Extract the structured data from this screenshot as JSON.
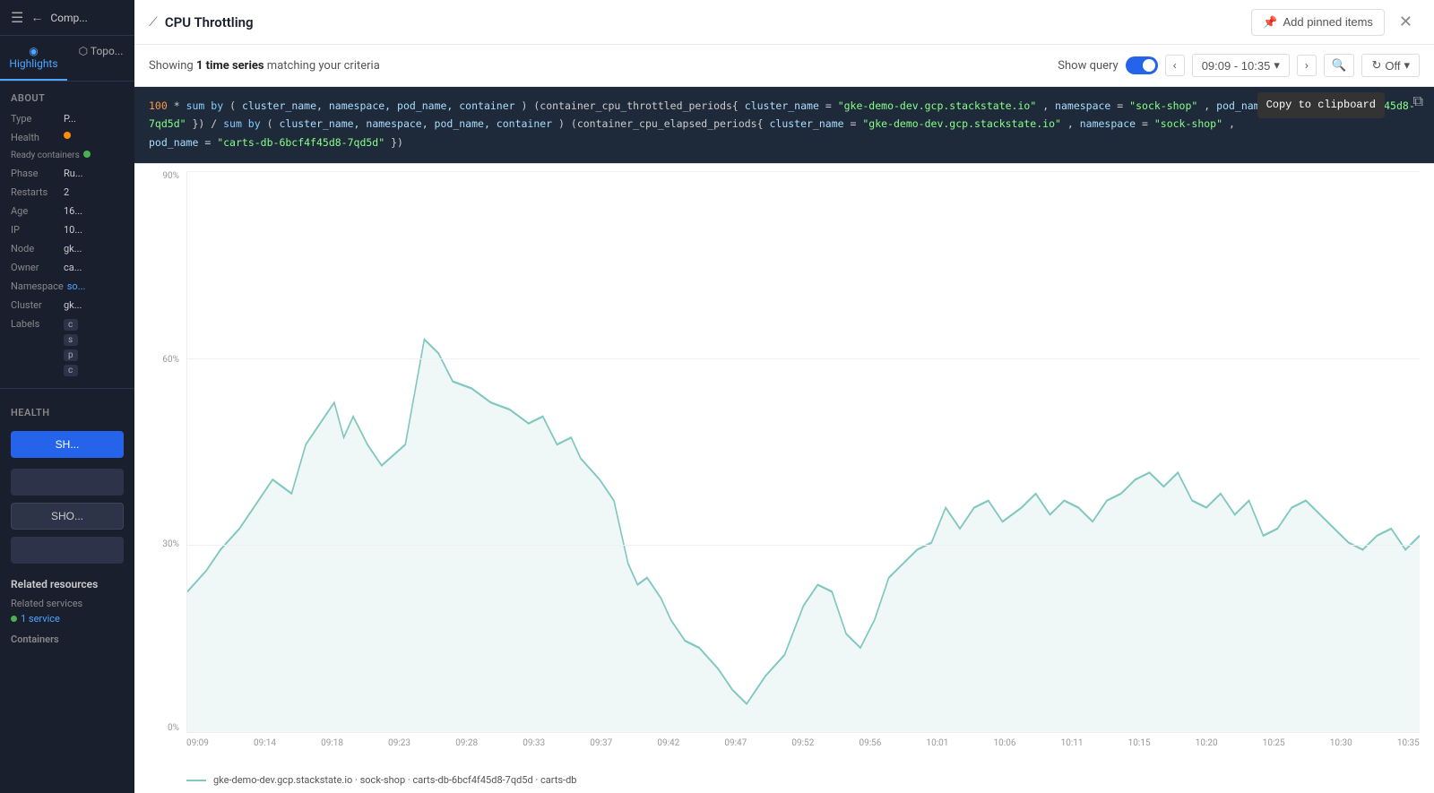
{
  "sidebar": {
    "hamburger": "☰",
    "back_arrow": "←",
    "comp_label": "Comp...",
    "tabs": [
      {
        "id": "highlights",
        "label": "Highlights",
        "icon": "◉",
        "active": true
      },
      {
        "id": "topo",
        "label": "Topo...",
        "icon": "⬡",
        "active": false
      }
    ],
    "about": {
      "section_label": "About",
      "fields": [
        {
          "label": "Type",
          "value": "P..."
        },
        {
          "label": "Health",
          "value": "",
          "has_dot": true,
          "dot_color": "orange"
        },
        {
          "label": "Ready containers",
          "value": "",
          "has_dot": true,
          "dot_color": "green"
        },
        {
          "label": "Phase",
          "value": "Ru..."
        },
        {
          "label": "Restarts",
          "value": "2"
        },
        {
          "label": "Age",
          "value": "16..."
        },
        {
          "label": "IP",
          "value": "10..."
        },
        {
          "label": "Node",
          "value": "gk..."
        },
        {
          "label": "Owner",
          "value": "ca..."
        },
        {
          "label": "Namespace",
          "value": "so..."
        },
        {
          "label": "Cluster",
          "value": "gk..."
        },
        {
          "label": "Labels",
          "value": "c..."
        }
      ],
      "label_pills": [
        "c",
        "s",
        "p",
        "c"
      ]
    },
    "health_section": {
      "label": "Health"
    },
    "show_btn": "SH...",
    "show_btn2": "SHO...",
    "related_resources": {
      "title": "Related resources",
      "services_label": "Related services",
      "service_link": "1 service",
      "containers_label": "Containers"
    }
  },
  "panel": {
    "icon": "📈",
    "title": "CPU Throttling",
    "add_pinned_label": "Add pinned items",
    "add_pinned_icon": "📌",
    "close_icon": "✕"
  },
  "criteria": {
    "prefix": "Showing ",
    "highlight": "1 time series",
    "suffix": " matching your criteria",
    "show_query_label": "Show query",
    "time_range": "09:09 - 10:35",
    "off_label": "Off"
  },
  "query": {
    "line1": "100 * sum by (cluster_name, namespace, pod_name, container) (container_cpu_throttled_periods{cluster_name=\"gke-demo-dev.gcp.stackstate.io\", namespace=\"sock-shop\", pod_name=\"carts-db-6bcf4f45d8-7qd5d\"}) / sum by (cluster_name, namespace, pod_name, container) (container_cpu_elapsed_periods{cluster_name=\"gke-demo-dev.gcp.stackstate.io\", namespace=\"sock-shop\",",
    "line2": "pod_name=\"carts-db-6bcf4f45d8-7qd5d\"})",
    "copy_label": "Copy to clipboard",
    "copy_icon": "⧉"
  },
  "chart": {
    "y_labels": [
      "90%",
      "60%",
      "30%",
      "0%"
    ],
    "x_labels": [
      "09:09",
      "09:14",
      "09:18",
      "09:23",
      "09:28",
      "09:33",
      "09:37",
      "09:42",
      "09:47",
      "09:52",
      "09:56",
      "10:01",
      "10:06",
      "10:11",
      "10:15",
      "10:20",
      "10:25",
      "10:30",
      "10:35"
    ],
    "legend_text": "gke-demo-dev.gcp.stackstate.io · sock-shop · carts-db-6bcf4f45d8-7qd5d · carts-db"
  }
}
